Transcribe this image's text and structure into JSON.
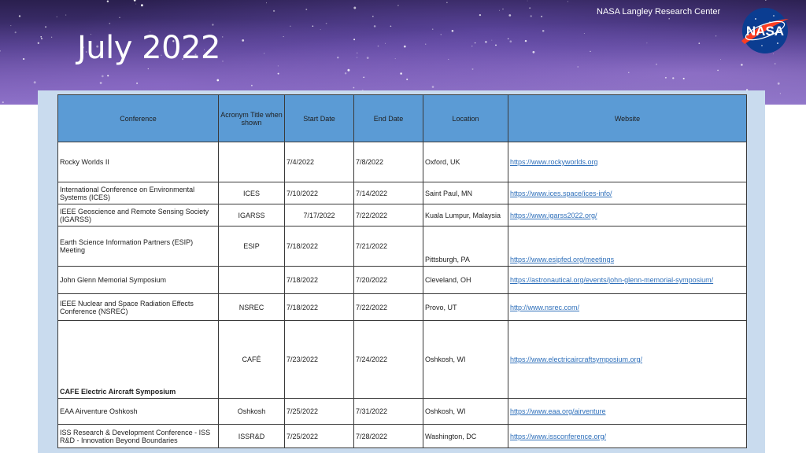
{
  "header": {
    "org": "NASA Langley Research Center",
    "title": "July 2022",
    "logo_text": "NASA"
  },
  "table": {
    "columns": [
      "Conference",
      "Acronym Title when shown",
      "Start Date",
      "End Date",
      "Location",
      "Website"
    ],
    "rows": [
      {
        "conference": "Rocky Worlds II",
        "acronym": "",
        "start": "7/4/2022",
        "end": "7/8/2022",
        "location": "Oxford, UK",
        "website": "https://www.rockyworlds.org"
      },
      {
        "conference": "International Conference on Environmental Systems (ICES)",
        "acronym": "ICES",
        "start": "7/10/2022",
        "end": "7/14/2022",
        "location": "Saint Paul, MN",
        "website": "https://www.ices.space/ices-info/"
      },
      {
        "conference": "IEEE Geoscience and Remote Sensing Society (IGARSS)",
        "acronym": "IGARSS",
        "start": "7/17/2022",
        "end": "7/22/2022",
        "location": "Kuala Lumpur, Malaysia",
        "website": "https://www.igarss2022.org/"
      },
      {
        "conference": "Earth Science Information Partners (ESIP) Meeting",
        "acronym": "ESIP",
        "start": "7/18/2022",
        "end": "7/21/2022",
        "location": "Pittsburgh, PA",
        "website": "https://www.esipfed.org/meetings"
      },
      {
        "conference": "John Glenn Memorial Symposium",
        "acronym": "",
        "start": "7/18/2022",
        "end": "7/20/2022",
        "location": "Cleveland, OH",
        "website": "https://astronautical.org/events/john-glenn-memorial-symposium/"
      },
      {
        "conference": "IEEE Nuclear and Space Radiation Effects Conference (NSREC)",
        "acronym": "NSREC",
        "start": "7/18/2022",
        "end": "7/22/2022",
        "location": "Provo, UT",
        "website": "http://www.nsrec.com/"
      },
      {
        "conference": "CAFE Electric Aircraft Symposium",
        "acronym": "CAFÉ",
        "start": "7/23/2022",
        "end": "7/24/2022",
        "location": "Oshkosh, WI",
        "website": "https://www.electricaircraftsymposium.org/"
      },
      {
        "conference": "EAA Airventure Oshkosh",
        "acronym": "Oshkosh",
        "start": "7/25/2022",
        "end": "7/31/2022",
        "location": "Oshkosh, WI",
        "website": "https://www.eaa.org/airventure"
      },
      {
        "conference": "ISS Research & Development Conference - ISS R&D - Innovation Beyond Boundaries",
        "acronym": "ISSR&D",
        "start": "7/25/2022",
        "end": "7/28/2022",
        "location": "Washington, DC",
        "website": "https://www.issconference.org/"
      }
    ]
  },
  "colors": {
    "header_fill": "#5b9bd5",
    "panel_bg": "#c9dbee",
    "link": "#2e6fba"
  }
}
